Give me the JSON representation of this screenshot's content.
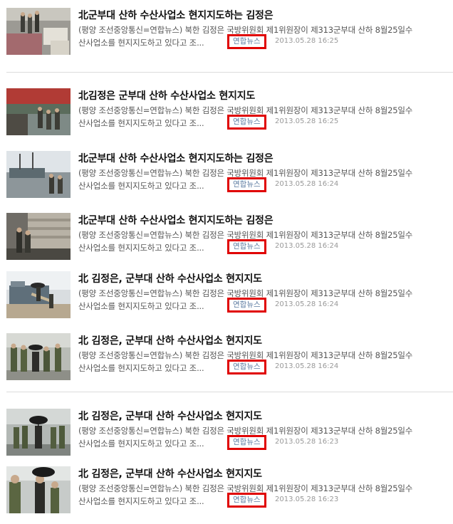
{
  "articles": [
    {
      "title": "北군부대 산하 수산사업소 현지지도하는 김정은",
      "line1": "(평양 조선중앙통신=연합뉴스) 북한 김정은 국방위원회 제1위원장이 제313군부대 산하 8월25일수",
      "line2": "산사업소를 현지지도하고 있다고 조...",
      "source": "연합뉴스",
      "date": "2013.05.28 16:25",
      "thumb": "icon-thumb-boxes"
    },
    {
      "title": "北김정은 군부대 산하 수산사업소 현지지도",
      "line1": "(평양 조선중앙통신=연합뉴스) 북한 김정은 국방위원회 제1위원장이 제313군부대 산하 8월25일수",
      "line2": "산사업소를 현지지도하고 있다고 조...",
      "source": "연합뉴스",
      "date": "2013.05.28 16:25",
      "thumb": "icon-thumb-crowd"
    },
    {
      "title": "北군부대 산하 수산사업소 현지지도하는 김정은",
      "line1": "(평양 조선중앙통신=연합뉴스) 북한 김정은 국방위원회 제1위원장이 제313군부대 산하 8월25일수",
      "line2": "산사업소를 현지지도하고 있다고 조...",
      "source": "연합뉴스",
      "date": "2013.05.28 16:24",
      "thumb": "icon-thumb-harbor"
    },
    {
      "title": "北군부대 산하 수산사업소 현지지도하는 김정은",
      "line1": "(평양 조선중앙통신=연합뉴스) 북한 김정은 국방위원회 제1위원장이 제313군부대 산하 8월25일수",
      "line2": "산사업소를 현지지도하고 있다고 조...",
      "source": "연합뉴스",
      "date": "2013.05.28 16:24",
      "thumb": "icon-thumb-stack"
    },
    {
      "title": "北 김정은, 군부대 산하 수산사업소 현지지도",
      "line1": "(평양 조선중앙통신=연합뉴스) 북한 김정은 국방위원회 제1위원장이 제313군부대 산하 8월25일수",
      "line2": "산사업소를 현지지도하고 있다고 조...",
      "source": "연합뉴스",
      "date": "2013.05.28 16:24",
      "thumb": "icon-thumb-ship"
    },
    {
      "title": "北 김정은, 군부대 산하 수산사업소 현지지도",
      "line1": "(평양 조선중앙통신=연합뉴스) 북한 김정은 국방위원회 제1위원장이 제313군부대 산하 8월25일수",
      "line2": "산사업소를 현지지도하고 있다고 조...",
      "source": "연합뉴스",
      "date": "2013.05.28 16:24",
      "thumb": "icon-thumb-soldiers"
    },
    {
      "title": "北 김정은, 군부대 산하 수산사업소 현지지도",
      "line1": "(평양 조선중앙통신=연합뉴스) 북한 김정은 국방위원회 제1위원장이 제313군부대 산하 8월25일수",
      "line2": "산사업소를 현지지도하고 있다고 조...",
      "source": "연합뉴스",
      "date": "2013.05.28 16:23",
      "thumb": "icon-thumb-umbrella"
    },
    {
      "title": "北 김정은, 군부대 산하 수산사업소 현지지도",
      "line1": "(평양 조선중앙통신=연합뉴스) 북한 김정은 국방위원회 제1위원장이 제313군부대 산하 8월25일수",
      "line2": "산사업소를 현지지도하고 있다고 조...",
      "source": "연합뉴스",
      "date": "2013.05.28 16:23",
      "thumb": "icon-thumb-closeup"
    }
  ],
  "colors": {
    "highlight_border": "#e00000",
    "source_text": "#5a7aa0",
    "title_text": "#111111",
    "body_text": "#555555",
    "date_text": "#999999"
  }
}
